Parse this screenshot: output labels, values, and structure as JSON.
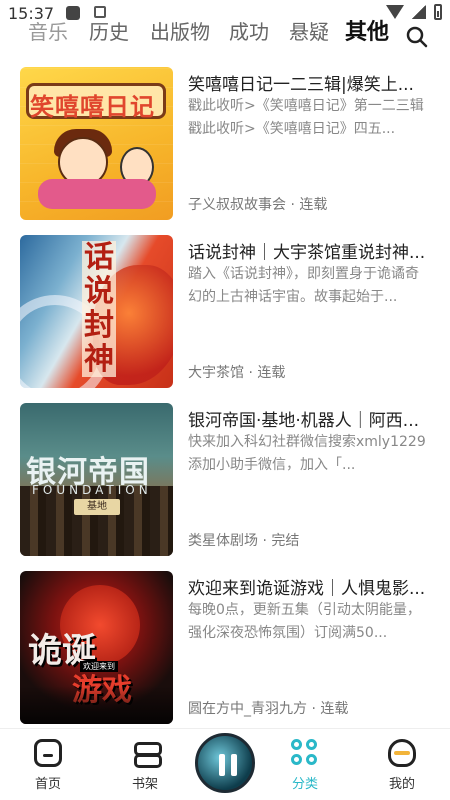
{
  "status_bar": {
    "time": "15:37"
  },
  "tabs": [
    "音乐",
    "历史",
    "出版物",
    "成功",
    "悬疑",
    "其他"
  ],
  "active_tab": "其他",
  "icons": {
    "search": "search-icon",
    "home": "home-icon",
    "shelf": "bookshelf-icon",
    "category": "category-icon",
    "mine": "profile-icon",
    "player": "pause-icon"
  },
  "list": [
    {
      "title": "笑嘻嘻日记一二三辑|爆笑上...",
      "desc": "戳此收听>《笑嘻嘻日记》第一二三辑戳此收听>《笑嘻嘻日记》四五...",
      "meta": "子义叔叔故事会 · 连载",
      "cover_text": "笑嘻嘻日记"
    },
    {
      "title": "话说封神｜大宇茶馆重说封神...",
      "desc": "踏入《话说封神》，即刻置身于诡谲奇幻的上古神话宇宙。故事起始于...",
      "meta": "大宇茶馆 · 连载",
      "cover_text": "话说封神"
    },
    {
      "title": "银河帝国·基地·机器人｜阿西...",
      "desc": "快来加入科幻社群微信搜索xmly1229添加小助手微信，加入「...",
      "meta": "类星体剧场 · 完结",
      "cover_text": "银河帝国",
      "cover_sub": "FOUNDATION",
      "cover_plate": "基地"
    },
    {
      "title": "欢迎来到诡诞游戏｜人惧鬼影...",
      "desc": "每晚0点，更新五集（引动太阴能量，强化深夜恐怖氛围）订阅满50...",
      "meta": "圆在方中_青羽九方 · 连载",
      "cover_text": "诡诞",
      "cover_text2": "游戏",
      "cover_small": "欢迎来到"
    }
  ],
  "bottom_nav": {
    "home": "首页",
    "shelf": "书架",
    "category": "分类",
    "mine": "我的"
  },
  "active_nav": "分类",
  "colors": {
    "accent": "#2ab8c8",
    "text": "#222222",
    "muted": "#888888"
  }
}
